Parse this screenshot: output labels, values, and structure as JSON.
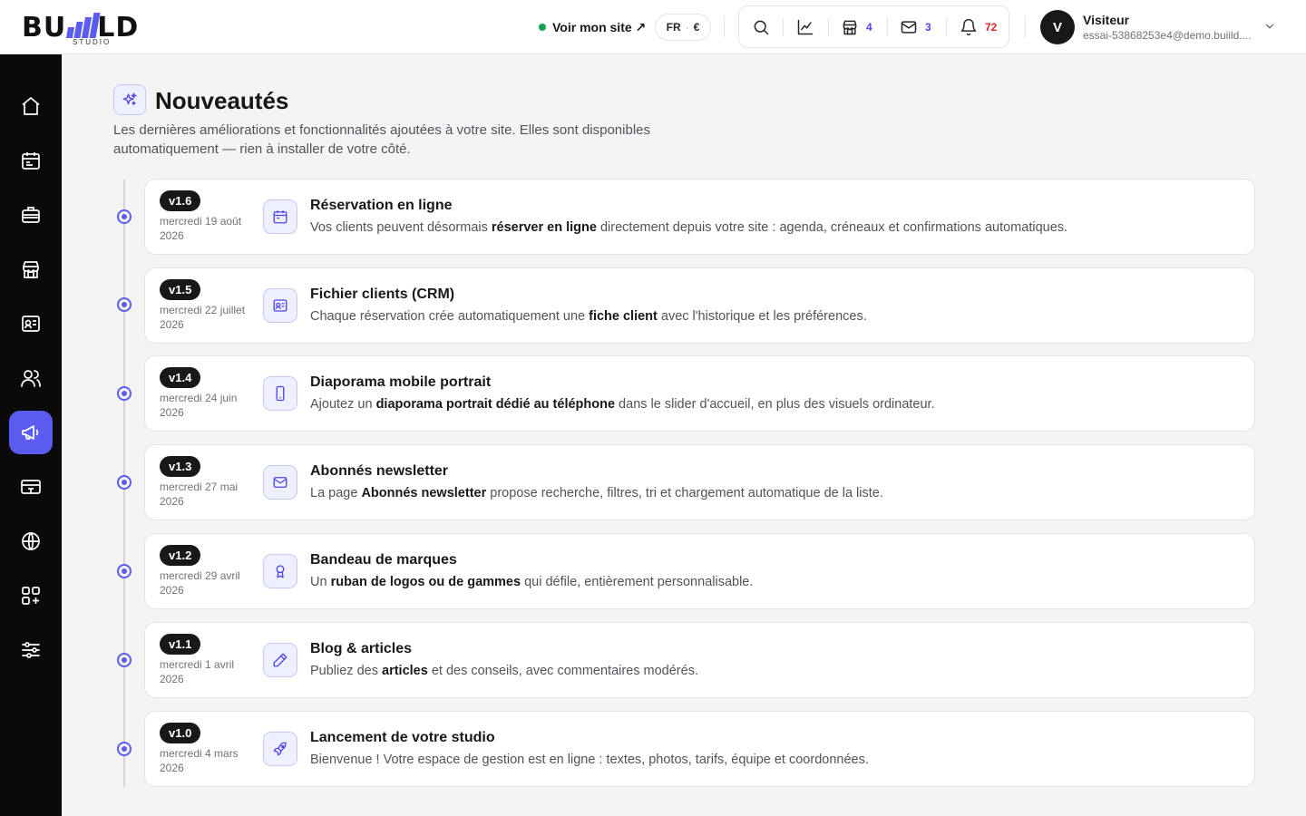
{
  "header": {
    "logo_text_left": "BU",
    "logo_text_right": "LD",
    "logo_sub": "STUDIO",
    "site_link": "Voir mon site ↗",
    "lang": "FR",
    "currency": "€",
    "tools": {
      "store_count": "4",
      "mail_count": "3",
      "notif_count": "72"
    },
    "user": {
      "initial": "V",
      "name": "Visiteur",
      "email": "essai-53868253e4@demo.buiild...."
    }
  },
  "sidebar": {
    "items": [
      "home-icon",
      "calendar-icon",
      "briefcase-icon",
      "store-icon",
      "contact-card-icon",
      "users-icon",
      "megaphone-icon",
      "payment-card-icon",
      "globe-icon",
      "apps-icon",
      "settings-sliders-icon"
    ],
    "active": "megaphone-icon",
    "accent": "#5b5bf0"
  },
  "page": {
    "title": "Nouveautés",
    "description": "Les dernières améliorations et fonctionnalités ajoutées à votre site. Elles sont disponibles automatiquement — rien à installer de votre côté."
  },
  "releases": [
    {
      "version": "v1.6",
      "date": "mercredi 19 août 2026",
      "icon": "calendar-icon",
      "title": "Réservation en ligne",
      "desc_before": "Vos clients peuvent désormais ",
      "desc_bold": "réserver en ligne",
      "desc_after": " directement depuis votre site : agenda, créneaux et confirmations automatiques."
    },
    {
      "version": "v1.5",
      "date": "mercredi 22 juillet 2026",
      "icon": "contact-card-icon",
      "title": "Fichier clients (CRM)",
      "desc_before": "Chaque réservation crée automatiquement une ",
      "desc_bold": "fiche client",
      "desc_after": " avec l'historique et les préférences."
    },
    {
      "version": "v1.4",
      "date": "mercredi 24 juin 2026",
      "icon": "smartphone-icon",
      "title": "Diaporama mobile portrait",
      "desc_before": "Ajoutez un ",
      "desc_bold": "diaporama portrait dédié au téléphone",
      "desc_after": " dans le slider d'accueil, en plus des visuels ordinateur."
    },
    {
      "version": "v1.3",
      "date": "mercredi 27 mai 2026",
      "icon": "mail-icon",
      "title": "Abonnés newsletter",
      "desc_before": "La page ",
      "desc_bold": "Abonnés newsletter",
      "desc_after": " propose recherche, filtres, tri et chargement automatique de la liste."
    },
    {
      "version": "v1.2",
      "date": "mercredi 29 avril 2026",
      "icon": "award-icon",
      "title": "Bandeau de marques",
      "desc_before": "Un ",
      "desc_bold": "ruban de logos ou de gammes",
      "desc_after": " qui défile, entièrement personnalisable."
    },
    {
      "version": "v1.1",
      "date": "mercredi 1 avril 2026",
      "icon": "pencil-icon",
      "title": "Blog & articles",
      "desc_before": "Publiez des ",
      "desc_bold": "articles",
      "desc_after": " et des conseils, avec commentaires modérés."
    },
    {
      "version": "v1.0",
      "date": "mercredi 4 mars 2026",
      "icon": "rocket-icon",
      "title": "Lancement de votre studio",
      "desc_before": "Bienvenue ! Votre espace de gestion est en ligne : textes, photos, tarifs, équipe et coordonnées.",
      "desc_bold": "",
      "desc_after": ""
    }
  ]
}
